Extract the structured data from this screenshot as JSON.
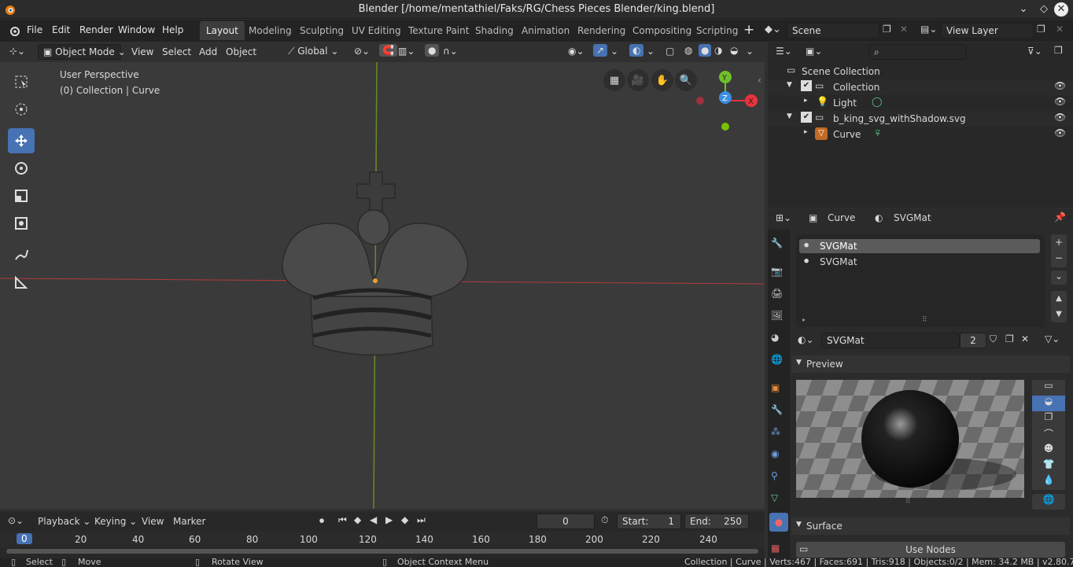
{
  "window": {
    "title": "Blender [/home/mentathiel/Faks/RG/Chess Pieces Blender/king.blend]"
  },
  "menu": {
    "file": "File",
    "edit": "Edit",
    "render": "Render",
    "window": "Window",
    "help": "Help"
  },
  "workspaces": [
    "Layout",
    "Modeling",
    "Sculpting",
    "UV Editing",
    "Texture Paint",
    "Shading",
    "Animation",
    "Rendering",
    "Compositing",
    "Scripting"
  ],
  "scene": {
    "name": "Scene",
    "view_layer": "View Layer"
  },
  "viewport_header": {
    "mode": "Object Mode",
    "view": "View",
    "select": "Select",
    "add": "Add",
    "object": "Object",
    "transform": "Global"
  },
  "viewport": {
    "perspective": "User Perspective",
    "context": "(0) Collection | Curve",
    "gizmo_y": "Y",
    "gizmo_x": "X",
    "gizmo_z": "Z"
  },
  "outliner": {
    "root": "Scene Collection",
    "items": [
      {
        "label": "Collection"
      },
      {
        "label": "Light"
      },
      {
        "label": "b_king_svg_withShadow.svg"
      },
      {
        "label": "Curve"
      }
    ]
  },
  "properties": {
    "object": "Curve",
    "material": "SVGMat",
    "slots": [
      "SVGMat",
      "SVGMat"
    ],
    "material_name": "SVGMat",
    "users": "2",
    "preview_label": "Preview",
    "surface_label": "Surface",
    "use_nodes": "Use Nodes"
  },
  "timeline": {
    "playback": "Playback",
    "keying": "Keying",
    "view": "View",
    "marker": "Marker",
    "current_frame": "0",
    "start_label": "Start:",
    "start": "1",
    "end_label": "End:",
    "end": "250",
    "ticks": [
      "0",
      "20",
      "40",
      "60",
      "80",
      "100",
      "120",
      "140",
      "160",
      "180",
      "200",
      "220",
      "240"
    ]
  },
  "status": {
    "select": "Select",
    "move": "Move",
    "rotate": "Rotate View",
    "context_menu": "Object Context Menu",
    "stats": "Collection | Curve | Verts:467 | Faces:691 | Tris:918 | Objects:0/2 | Mem: 34.2 MB | v2.80.75"
  },
  "colors": {
    "accent": "#4772b3",
    "x_axis": "#e8333f",
    "y_axis": "#6fbf2a",
    "z_axis": "#3b8fe0"
  }
}
